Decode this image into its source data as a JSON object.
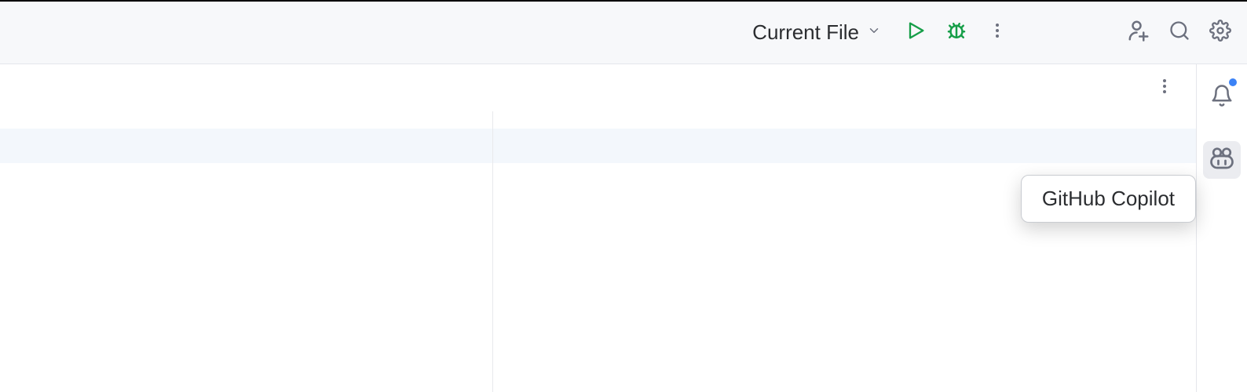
{
  "toolbar": {
    "run_config_label": "Current File"
  },
  "tooltip": {
    "copilot": "GitHub Copilot"
  },
  "colors": {
    "run_green": "#169e48",
    "icon_gray": "#6c707e",
    "notif_blue": "#3b82f6"
  }
}
